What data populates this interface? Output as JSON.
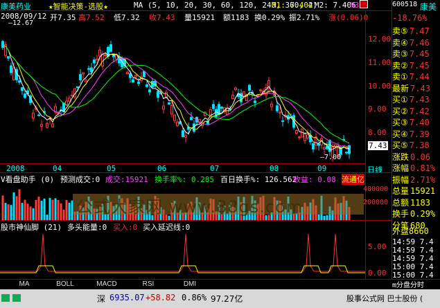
{
  "header": {
    "stock_name": "康美药业",
    "formula": "★智能决策-选股★",
    "ma_params": "MA (5, 10, 20, 30, 60, 120, 240, 360, 4)",
    "m1": "M1: 7.402",
    "m2": "M2: 7.406",
    "m3": "M3",
    "code": "600518",
    "code_name": "康美"
  },
  "info": {
    "date": "2008/09/12",
    "open": "开7.35",
    "high": "高7.52",
    "low": "低7.32",
    "close": "收7.43",
    "volume": "量15921",
    "amount": "额1183",
    "turnover": "换0.29%",
    "amplitude": "振2.71%",
    "change": "涨(0.06)0"
  },
  "price_axis": {
    "labels": [
      "12.00",
      "11.00",
      "10.00",
      "9.00",
      "8.00"
    ],
    "high_mark": "12.67",
    "low_mark": "7.00",
    "current_price": "7.43"
  },
  "time_axis": {
    "labels": [
      "2008",
      "04",
      "05",
      "06",
      "07",
      "08",
      "09"
    ],
    "right_label": "日线"
  },
  "volume_panel": {
    "title": "V看盘助手 (0)",
    "forecast": "预测成交:0",
    "volume": "成交:15921",
    "turnover": "换手率%: 0.285",
    "daily_turnover": "百日换手%: 126.562",
    "profit": "收益: 0.08",
    "float_label": "流通亿",
    "axis": [
      "400000",
      "200000"
    ],
    "watermark": "公式大家网  www.88gs.com"
  },
  "indicator_panel": {
    "title": "股市神仙脚 (21)",
    "energy": "多头能量:0",
    "buy": "买入:0",
    "buy_line": "买入延迟线:0",
    "axis": [
      "5.00",
      "0.00"
    ]
  },
  "tabs": [
    "MA",
    "BOLL",
    "MACD",
    "RSI",
    "DMI"
  ],
  "statusbar": {
    "market": "深",
    "index": "6935.07",
    "change": "+58.82",
    "percent": "0.86%",
    "amount": "97.27亿",
    "ticker_text": "股事公式网  巴士股份  ("
  },
  "side_panel": {
    "wei_bi": "-18.76%",
    "sells": [
      {
        "label": "卖⑤",
        "price": "7.47"
      },
      {
        "label": "卖④",
        "price": "7.46"
      },
      {
        "label": "卖③",
        "price": "7.45"
      },
      {
        "label": "卖②",
        "price": "7.45"
      },
      {
        "label": "卖①",
        "price": "7.44"
      }
    ],
    "latest_label": "最新",
    "latest": "7.43",
    "buys": [
      {
        "label": "买①",
        "price": "7.43"
      },
      {
        "label": "买②",
        "price": "7.42"
      },
      {
        "label": "买③",
        "price": "7.40"
      },
      {
        "label": "买④",
        "price": "7.39"
      },
      {
        "label": "买⑤",
        "price": "7.38"
      }
    ],
    "stats": [
      {
        "label": "涨跌",
        "value": "0.06"
      },
      {
        "label": "涨幅",
        "value": "0.81%"
      },
      {
        "label": "振幅",
        "value": "2.71%"
      },
      {
        "label": "总量",
        "value": "15921"
      },
      {
        "label": "总额",
        "value": "1183"
      },
      {
        "label": "换手",
        "value": "0.29%"
      },
      {
        "label": "分笔",
        "value": "680"
      }
    ],
    "outer": "外盘8660",
    "ticks": [
      "14:59",
      "14:59",
      "14:59",
      "15:00",
      "15:00"
    ],
    "tick_prices": [
      "7.4",
      "7.4",
      "7.4",
      "7.4",
      "7.4"
    ],
    "footer": "m分盘分时"
  }
}
